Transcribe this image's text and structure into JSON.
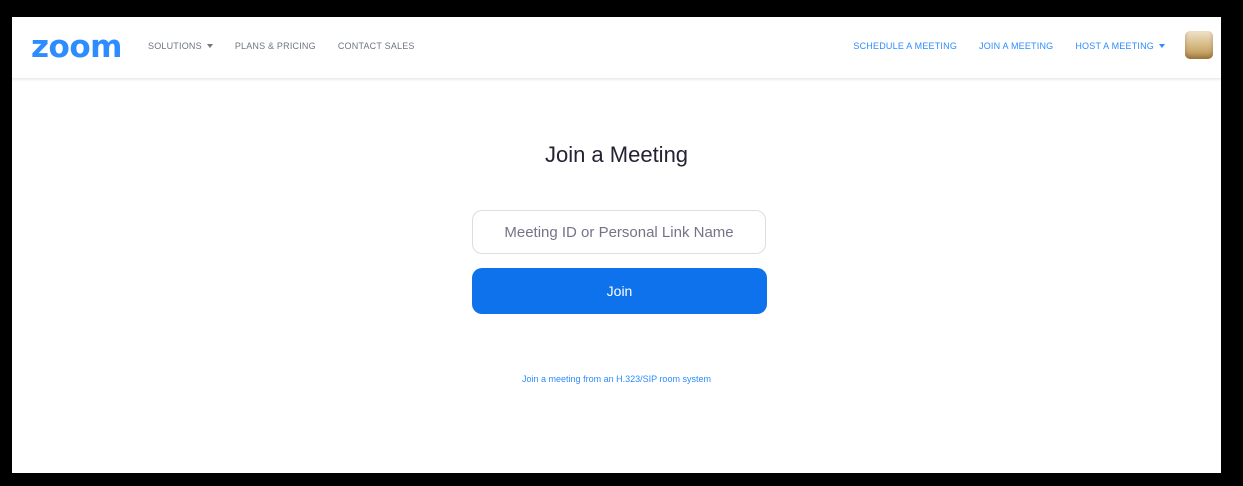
{
  "brand": {
    "logo_text": "zoom",
    "accent_color": "#2D8CFF",
    "button_color": "#0E72ED"
  },
  "nav": {
    "left": [
      {
        "label": "SOLUTIONS",
        "has_dropdown": true
      },
      {
        "label": "PLANS & PRICING",
        "has_dropdown": false
      },
      {
        "label": "CONTACT SALES",
        "has_dropdown": false
      }
    ],
    "right": [
      {
        "label": "SCHEDULE A MEETING",
        "has_dropdown": false
      },
      {
        "label": "JOIN A MEETING",
        "has_dropdown": false
      },
      {
        "label": "HOST A MEETING",
        "has_dropdown": true
      }
    ],
    "avatar_icon": "user-avatar-icon"
  },
  "main": {
    "title": "Join a Meeting",
    "meeting_input": {
      "placeholder": "Meeting ID or Personal Link Name",
      "value": ""
    },
    "join_label": "Join",
    "sip_link": "Join a meeting from an H.323/SIP room system"
  }
}
